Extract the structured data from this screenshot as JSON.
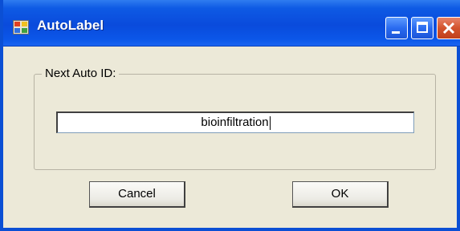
{
  "window": {
    "title": "AutoLabel",
    "title_icon": "application-window-icon",
    "controls": {
      "minimize_icon": "minimize-icon",
      "maximize_icon": "maximize-icon",
      "close_icon": "close-icon"
    },
    "colors": {
      "titlebar": "#0a4bdc",
      "close_button": "#d3532d",
      "body": "#ece9d8"
    }
  },
  "group": {
    "label": "Next Auto ID:"
  },
  "auto_id_field": {
    "value": "bioinfiltration"
  },
  "buttons": {
    "cancel_label": "Cancel",
    "ok_label": "OK"
  }
}
